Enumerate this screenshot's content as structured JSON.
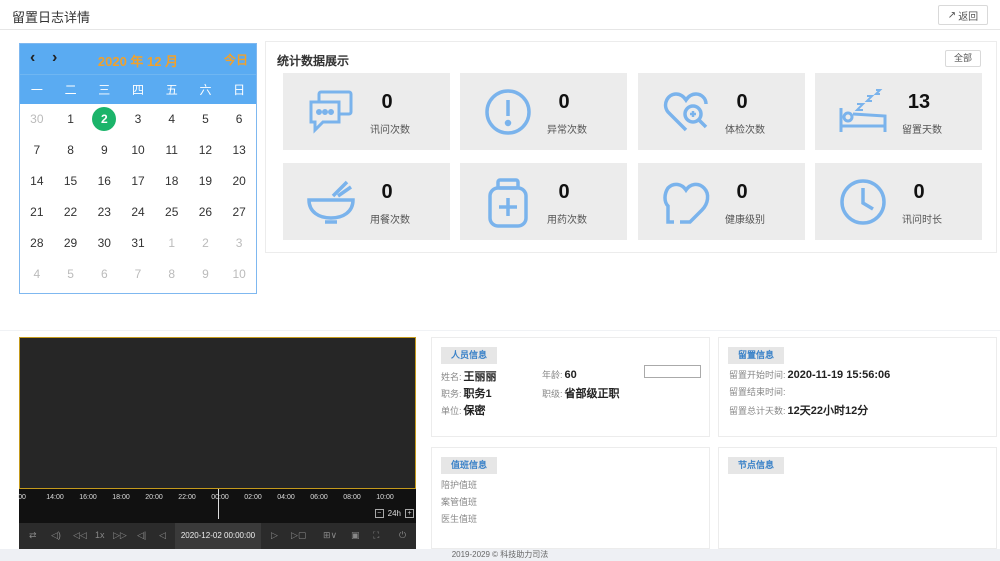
{
  "header": {
    "title": "留置日志详情",
    "back_label": "返回"
  },
  "calendar": {
    "month_label": "2020 年 12 月",
    "today_label": "今日",
    "weekdays": [
      "一",
      "二",
      "三",
      "四",
      "五",
      "六",
      "日"
    ],
    "days": [
      {
        "d": "30",
        "m": true
      },
      {
        "d": "1"
      },
      {
        "d": "2",
        "sel": true
      },
      {
        "d": "3"
      },
      {
        "d": "4"
      },
      {
        "d": "5"
      },
      {
        "d": "6"
      },
      {
        "d": "7"
      },
      {
        "d": "8"
      },
      {
        "d": "9"
      },
      {
        "d": "10"
      },
      {
        "d": "11"
      },
      {
        "d": "12"
      },
      {
        "d": "13"
      },
      {
        "d": "14"
      },
      {
        "d": "15"
      },
      {
        "d": "16"
      },
      {
        "d": "17"
      },
      {
        "d": "18"
      },
      {
        "d": "19"
      },
      {
        "d": "20"
      },
      {
        "d": "21"
      },
      {
        "d": "22"
      },
      {
        "d": "23"
      },
      {
        "d": "24"
      },
      {
        "d": "25"
      },
      {
        "d": "26"
      },
      {
        "d": "27"
      },
      {
        "d": "28"
      },
      {
        "d": "29"
      },
      {
        "d": "30"
      },
      {
        "d": "31"
      },
      {
        "d": "1",
        "m": true
      },
      {
        "d": "2",
        "m": true
      },
      {
        "d": "3",
        "m": true
      },
      {
        "d": "4",
        "m": true
      },
      {
        "d": "5",
        "m": true
      },
      {
        "d": "6",
        "m": true
      },
      {
        "d": "7",
        "m": true
      },
      {
        "d": "8",
        "m": true
      },
      {
        "d": "9",
        "m": true
      },
      {
        "d": "10",
        "m": true
      }
    ]
  },
  "stats": {
    "title": "统计数据展示",
    "all_label": "全部",
    "cards": [
      {
        "value": "0",
        "label": "讯问次数",
        "icon": "chat-icon"
      },
      {
        "value": "0",
        "label": "异常次数",
        "icon": "alert-icon"
      },
      {
        "value": "0",
        "label": "体检次数",
        "icon": "health-check-icon"
      },
      {
        "value": "13",
        "label": "留置天数",
        "icon": "sleep-bed-icon"
      },
      {
        "value": "0",
        "label": "用餐次数",
        "icon": "bowl-icon"
      },
      {
        "value": "0",
        "label": "用药次数",
        "icon": "medicine-icon"
      },
      {
        "value": "0",
        "label": "健康级别",
        "icon": "heart-icon"
      },
      {
        "value": "0",
        "label": "讯问时长",
        "icon": "clock-icon"
      }
    ],
    "icon_color": "#7ab3ec"
  },
  "video": {
    "ticks": [
      "00",
      "14:00",
      "16:00",
      "18:00",
      "20:00",
      "22:00",
      "00:00",
      "02:00",
      "04:00",
      "06:00",
      "08:00",
      "10:00"
    ],
    "zoom_label": "24h",
    "speed_label": "1x",
    "datetime": "2020-12-02 00:00:00"
  },
  "person": {
    "title": "人员信息",
    "name_k": "姓名:",
    "name_v": "王丽丽",
    "age_k": "年龄:",
    "age_v": "60",
    "post_k": "职务:",
    "post_v": "职务1",
    "level_k": "职级:",
    "level_v": "省部级正职",
    "unit_k": "单位:",
    "unit_v": "保密"
  },
  "detention": {
    "title": "留置信息",
    "start_k": "留置开始时间:",
    "start_v": "2020-11-19 15:56:06",
    "end_k": "留置结束时间:",
    "end_v": "",
    "total_k": "留置总计天数:",
    "total_v": "12天22小时12分"
  },
  "duty": {
    "title": "值班信息",
    "row1": "陪护值班",
    "row2": "案管值班",
    "row3": "医生值班"
  },
  "node": {
    "title": "节点信息"
  },
  "footer": {
    "text": "2019-2029 © 科技助力司法"
  }
}
